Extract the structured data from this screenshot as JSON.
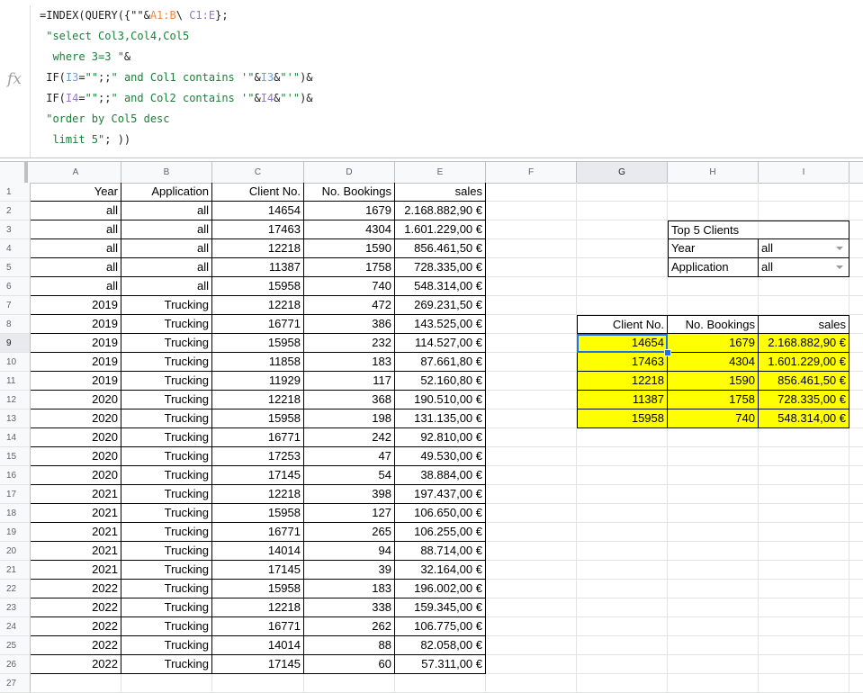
{
  "formula_bar": {
    "fx_label": "fx",
    "lines": [
      [
        {
          "t": "=INDEX(QUERY({\"\"&",
          "c": ""
        },
        {
          "t": "A1:B",
          "c": "f-ref1"
        },
        {
          "t": "\\ ",
          "c": ""
        },
        {
          "t": "C1:E",
          "c": "f-ref3"
        },
        {
          "t": "};",
          "c": ""
        }
      ],
      [
        {
          "t": " \"select Col3,Col4,Col5",
          "c": "f-str"
        }
      ],
      [
        {
          "t": "  where 3=3 \"",
          "c": "f-str"
        },
        {
          "t": "&",
          "c": ""
        }
      ],
      [
        {
          "t": " IF(",
          "c": ""
        },
        {
          "t": "I3",
          "c": "f-ref2"
        },
        {
          "t": "=",
          "c": ""
        },
        {
          "t": "\"\"",
          "c": "f-str"
        },
        {
          "t": ";;",
          "c": ""
        },
        {
          "t": "\" and Col1 contains '\"",
          "c": "f-str"
        },
        {
          "t": "&",
          "c": ""
        },
        {
          "t": "I3",
          "c": "f-ref2"
        },
        {
          "t": "&",
          "c": ""
        },
        {
          "t": "\"'\"",
          "c": "f-str"
        },
        {
          "t": ")&",
          "c": ""
        }
      ],
      [
        {
          "t": " IF(",
          "c": ""
        },
        {
          "t": "I4",
          "c": "f-ref3"
        },
        {
          "t": "=",
          "c": ""
        },
        {
          "t": "\"\"",
          "c": "f-str"
        },
        {
          "t": ";;",
          "c": ""
        },
        {
          "t": "\" and Col2 contains '\"",
          "c": "f-str"
        },
        {
          "t": "&",
          "c": ""
        },
        {
          "t": "I4",
          "c": "f-ref3"
        },
        {
          "t": "&",
          "c": ""
        },
        {
          "t": "\"'\"",
          "c": "f-str"
        },
        {
          "t": ")&",
          "c": ""
        }
      ],
      [
        {
          "t": " \"order by Col5 desc",
          "c": "f-str"
        }
      ],
      [
        {
          "t": "  limit 5\"",
          "c": "f-str"
        },
        {
          "t": "; ))",
          "c": ""
        }
      ]
    ]
  },
  "grid": {
    "columns": [
      "A",
      "B",
      "C",
      "D",
      "E",
      "F",
      "G",
      "H",
      "I",
      ""
    ],
    "selected_column": "G",
    "selected_row": 9,
    "row_numbers": [
      1,
      2,
      3,
      4,
      5,
      6,
      7,
      8,
      9,
      10,
      11,
      12,
      13,
      14,
      15,
      16,
      17,
      18,
      19,
      20,
      21,
      22,
      23,
      24,
      25,
      26,
      27
    ]
  },
  "source_table": {
    "headers": [
      "Year",
      "Application",
      "Client No.",
      "No. Bookings",
      "sales"
    ],
    "rows": [
      [
        "all",
        "all",
        "14654",
        "1679",
        "2.168.882,90 €"
      ],
      [
        "all",
        "all",
        "17463",
        "4304",
        "1.601.229,00 €"
      ],
      [
        "all",
        "all",
        "12218",
        "1590",
        "856.461,50 €"
      ],
      [
        "all",
        "all",
        "11387",
        "1758",
        "728.335,00 €"
      ],
      [
        "all",
        "all",
        "15958",
        "740",
        "548.314,00 €"
      ],
      [
        "2019",
        "Trucking",
        "12218",
        "472",
        "269.231,50 €"
      ],
      [
        "2019",
        "Trucking",
        "16771",
        "386",
        "143.525,00 €"
      ],
      [
        "2019",
        "Trucking",
        "15958",
        "232",
        "114.527,00 €"
      ],
      [
        "2019",
        "Trucking",
        "11858",
        "183",
        "87.661,80 €"
      ],
      [
        "2019",
        "Trucking",
        "11929",
        "117",
        "52.160,80 €"
      ],
      [
        "2020",
        "Trucking",
        "12218",
        "368",
        "190.510,00 €"
      ],
      [
        "2020",
        "Trucking",
        "15958",
        "198",
        "131.135,00 €"
      ],
      [
        "2020",
        "Trucking",
        "16771",
        "242",
        "92.810,00 €"
      ],
      [
        "2020",
        "Trucking",
        "17253",
        "47",
        "49.530,00 €"
      ],
      [
        "2020",
        "Trucking",
        "17145",
        "54",
        "38.884,00 €"
      ],
      [
        "2021",
        "Trucking",
        "12218",
        "398",
        "197.437,00 €"
      ],
      [
        "2021",
        "Trucking",
        "15958",
        "127",
        "106.650,00 €"
      ],
      [
        "2021",
        "Trucking",
        "16771",
        "265",
        "106.255,00 €"
      ],
      [
        "2021",
        "Trucking",
        "14014",
        "94",
        "88.714,00 €"
      ],
      [
        "2021",
        "Trucking",
        "17145",
        "39",
        "32.164,00 €"
      ],
      [
        "2022",
        "Trucking",
        "15958",
        "183",
        "196.002,00 €"
      ],
      [
        "2022",
        "Trucking",
        "12218",
        "338",
        "159.345,00 €"
      ],
      [
        "2022",
        "Trucking",
        "16771",
        "262",
        "106.775,00 €"
      ],
      [
        "2022",
        "Trucking",
        "14014",
        "88",
        "82.058,00 €"
      ],
      [
        "2022",
        "Trucking",
        "17145",
        "60",
        "57.311,00 €"
      ]
    ]
  },
  "filter_panel": {
    "title": "Top 5 Clients",
    "year_label": "Year",
    "year_value": "all",
    "application_label": "Application",
    "application_value": "all"
  },
  "result_table": {
    "headers": [
      "Client No.",
      "No. Bookings",
      "sales"
    ],
    "rows": [
      [
        "14654",
        "1679",
        "2.168.882,90 €"
      ],
      [
        "17463",
        "4304",
        "1.601.229,00 €"
      ],
      [
        "12218",
        "1590",
        "856.461,50 €"
      ],
      [
        "11387",
        "1758",
        "728.335,00 €"
      ],
      [
        "15958",
        "740",
        "548.314,00 €"
      ]
    ],
    "highlight_color": "#ffff00",
    "selection_color": "#1a73e8"
  }
}
